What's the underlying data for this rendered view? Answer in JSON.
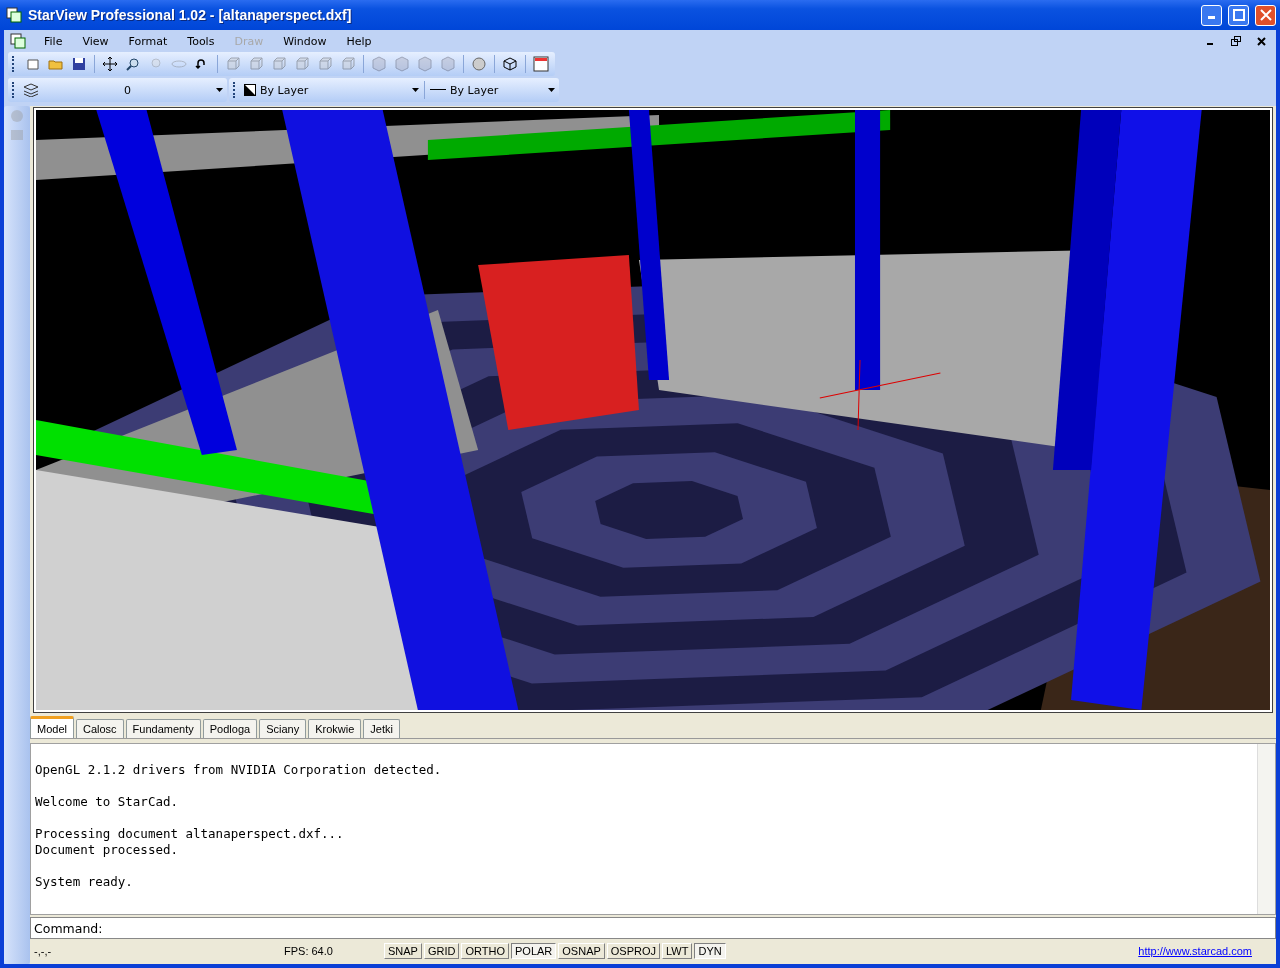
{
  "window": {
    "title": "StarView Professional 1.02 - [altanaperspect.dxf]"
  },
  "menu": [
    {
      "label": "File",
      "disabled": false
    },
    {
      "label": "View",
      "disabled": false
    },
    {
      "label": "Format",
      "disabled": false
    },
    {
      "label": "Tools",
      "disabled": false
    },
    {
      "label": "Draw",
      "disabled": true
    },
    {
      "label": "Window",
      "disabled": false
    },
    {
      "label": "Help",
      "disabled": false
    }
  ],
  "toolbar": [
    {
      "kind": "new",
      "disabled": false
    },
    {
      "kind": "open",
      "disabled": false
    },
    {
      "kind": "save",
      "disabled": false
    },
    {
      "kind": "sep"
    },
    {
      "kind": "pan",
      "disabled": false
    },
    {
      "kind": "zoom",
      "disabled": false
    },
    {
      "kind": "zoomdrop",
      "disabled": true
    },
    {
      "kind": "orbit",
      "disabled": true
    },
    {
      "kind": "undo",
      "disabled": false
    },
    {
      "kind": "sep"
    },
    {
      "kind": "cube",
      "disabled": true
    },
    {
      "kind": "cube",
      "disabled": true
    },
    {
      "kind": "cube",
      "disabled": true
    },
    {
      "kind": "cube",
      "disabled": true
    },
    {
      "kind": "cube",
      "disabled": true
    },
    {
      "kind": "cube",
      "disabled": true
    },
    {
      "kind": "sep"
    },
    {
      "kind": "iso",
      "disabled": true
    },
    {
      "kind": "iso",
      "disabled": true
    },
    {
      "kind": "iso",
      "disabled": true
    },
    {
      "kind": "iso",
      "disabled": true
    },
    {
      "kind": "sep"
    },
    {
      "kind": "sphere",
      "disabled": false
    },
    {
      "kind": "sep"
    },
    {
      "kind": "wire",
      "disabled": false
    },
    {
      "kind": "sep"
    },
    {
      "kind": "palette",
      "disabled": false
    }
  ],
  "layer_field": {
    "value": "0"
  },
  "color_field": {
    "value": "By Layer"
  },
  "linetype_field": {
    "value": "By Layer"
  },
  "layout_tabs": [
    {
      "label": "Model",
      "selected": true
    },
    {
      "label": "Calosc",
      "selected": false
    },
    {
      "label": "Fundamenty",
      "selected": false
    },
    {
      "label": "Podloga",
      "selected": false
    },
    {
      "label": "Sciany",
      "selected": false
    },
    {
      "label": "Krokwie",
      "selected": false
    },
    {
      "label": "Jetki",
      "selected": false
    }
  ],
  "output": [
    [
      "OpenGL 2.1.2 drivers from NVIDIA Corporation detected."
    ],
    [
      "Welcome to StarCad."
    ],
    [
      "Processing document altanaperspect.dxf...",
      "Document processed."
    ],
    [
      "System ready."
    ]
  ],
  "command": {
    "label": "Command:"
  },
  "status_bar": {
    "coords": "-,-,-",
    "fps": "FPS: 64.0",
    "toggles": [
      {
        "label": "SNAP",
        "on": false
      },
      {
        "label": "GRID",
        "on": false
      },
      {
        "label": "ORTHO",
        "on": false
      },
      {
        "label": "POLAR",
        "on": true
      },
      {
        "label": "OSNAP",
        "on": false
      },
      {
        "label": "OSPROJ",
        "on": false
      },
      {
        "label": "LWT",
        "on": false
      },
      {
        "label": "DYN",
        "on": true
      }
    ],
    "link": "http://www.starcad.com"
  }
}
